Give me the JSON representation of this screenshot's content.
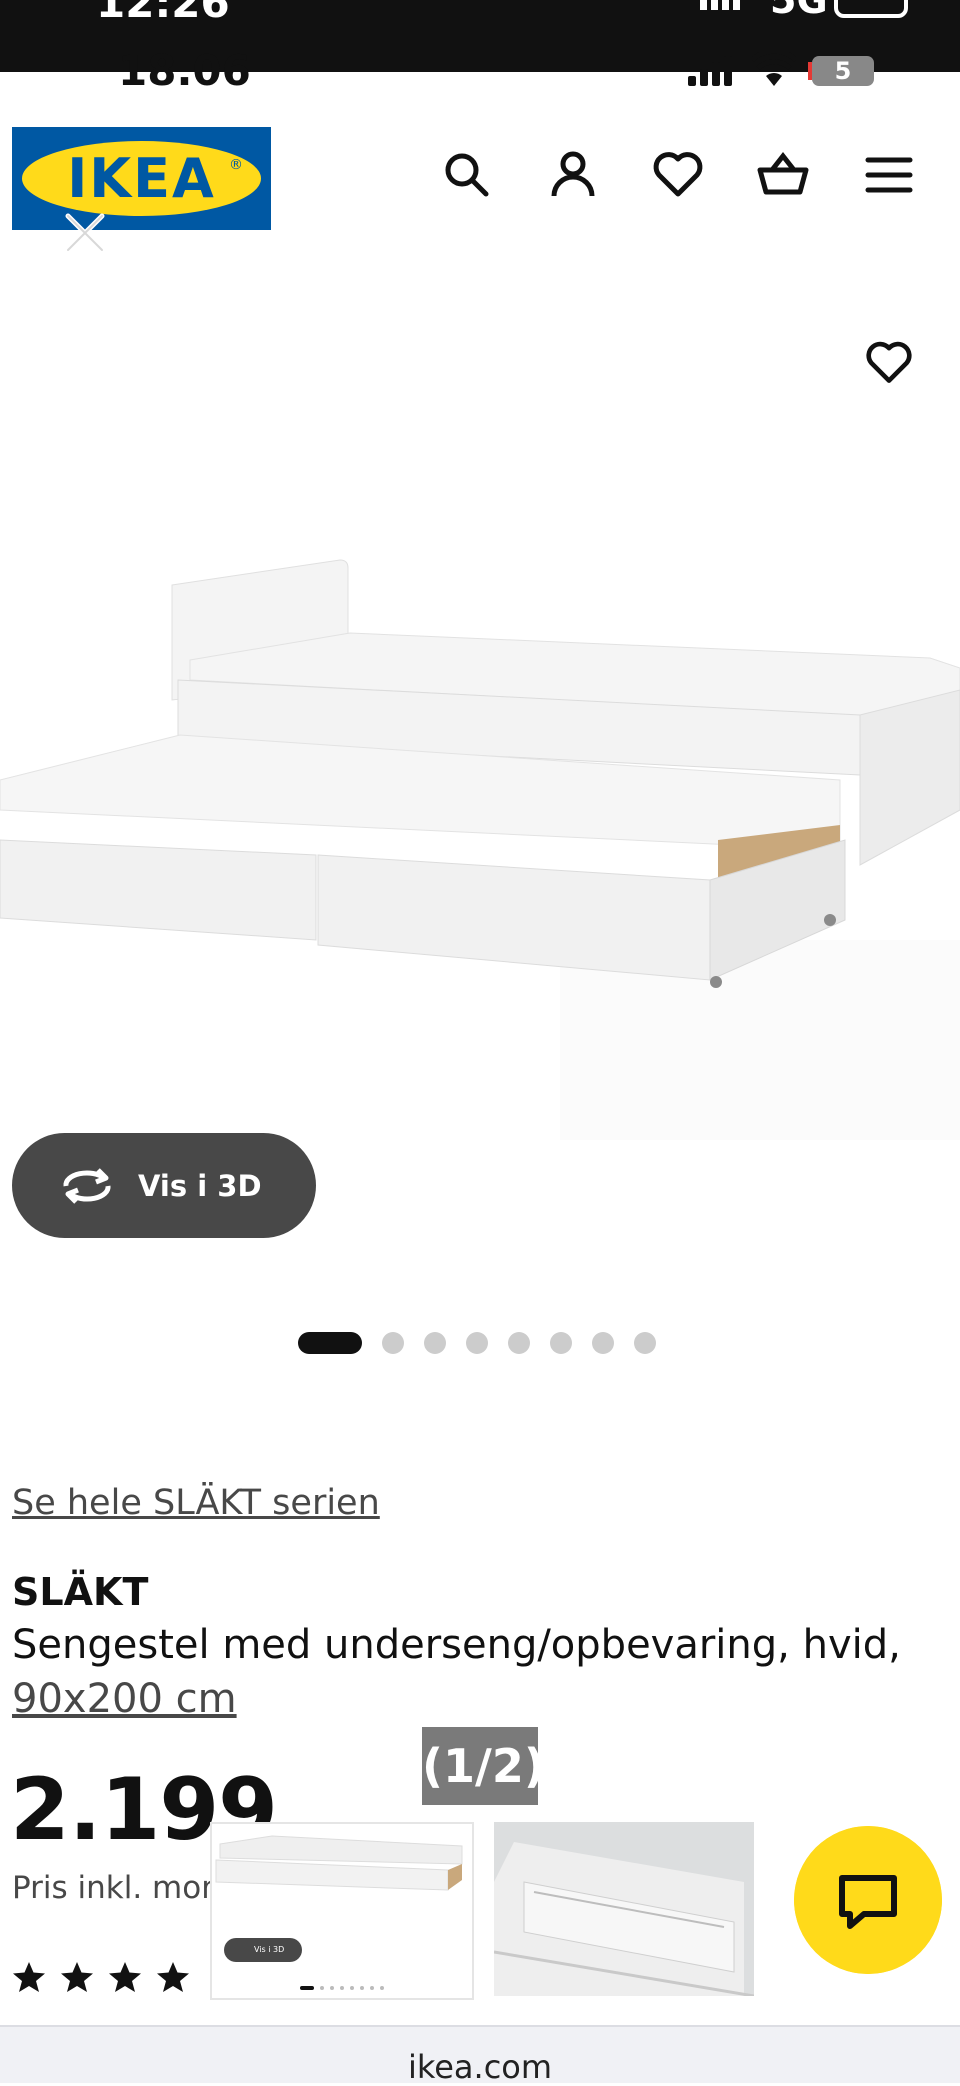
{
  "outer_status": {
    "time": "12:26",
    "network": "5G"
  },
  "inner_status": {
    "time": "18.06",
    "battery": "5"
  },
  "header": {
    "logo_text": "IKEA",
    "icons": [
      "search-icon",
      "account-icon",
      "heart-icon",
      "basket-icon",
      "menu-icon"
    ]
  },
  "hero": {
    "view_3d_label": "Vis i 3D",
    "image_count": 8,
    "active_image": 1
  },
  "product": {
    "series_link": "Se hele SLÄKT serien",
    "name": "SLÄKT",
    "description": "Sengestel med underseng/opbevaring, hvid,",
    "size": "90x200 cm",
    "price": "2.199",
    "price_note": "Pris inkl. mon",
    "rating_stars_visible": 4
  },
  "overlay": {
    "counter": "(1/2)",
    "thumb_3d_label": "Vis i 3D"
  },
  "browser": {
    "url": "ikea.com"
  },
  "colors": {
    "ikea_blue": "#0058a3",
    "ikea_yellow": "#ffda1a",
    "dark_button": "#484848"
  }
}
